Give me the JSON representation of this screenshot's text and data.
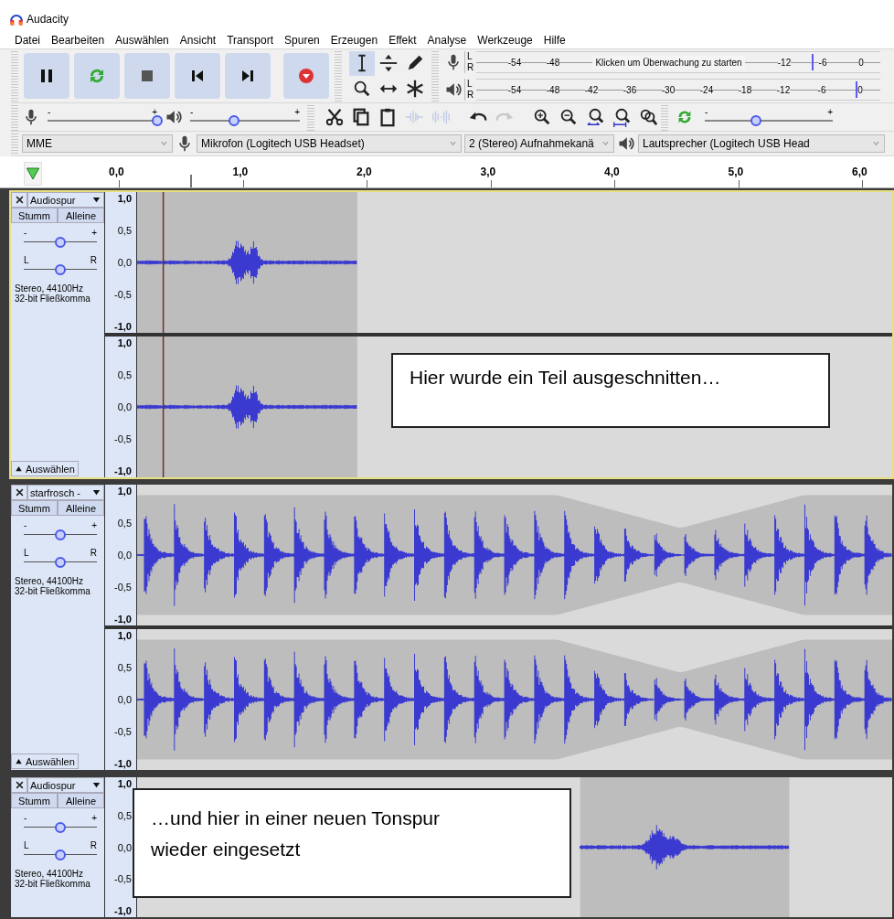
{
  "window": {
    "title": "Audacity"
  },
  "menu": [
    "Datei",
    "Bearbeiten",
    "Auswählen",
    "Ansicht",
    "Transport",
    "Spuren",
    "Erzeugen",
    "Effekt",
    "Analyse",
    "Werkzeuge",
    "Hilfe"
  ],
  "transport": [
    {
      "kind": "pause"
    },
    {
      "kind": "loop"
    },
    {
      "kind": "stop"
    },
    {
      "kind": "skip_start"
    },
    {
      "kind": "skip_end"
    },
    {
      "kind": "record"
    }
  ],
  "tools": [
    {
      "kind": "select",
      "selected": true
    },
    {
      "kind": "envelope",
      "selected": false
    },
    {
      "kind": "draw",
      "selected": false
    },
    {
      "kind": "zoom",
      "selected": false
    },
    {
      "kind": "timeshift",
      "selected": false
    },
    {
      "kind": "multi",
      "selected": false
    }
  ],
  "meters": [
    {
      "kind": "record",
      "channels": [
        "L",
        "R"
      ],
      "message": "Klicken um Überwachung zu starten",
      "ticks": [
        "-54",
        "-48",
        "-12",
        "-6",
        "0"
      ],
      "level": 0.83
    },
    {
      "kind": "playback",
      "channels": [
        "L",
        "R"
      ],
      "ticks": [
        "-54",
        "-48",
        "-42",
        "-36",
        "-30",
        "-24",
        "-18",
        "-12",
        "-6",
        "0"
      ],
      "level": 0.94
    }
  ],
  "mixer": [
    {
      "kind": "mic",
      "min": "-",
      "max": "+",
      "level": 1.0
    },
    {
      "kind": "speaker",
      "min": "-",
      "max": "+",
      "level": 0.4
    }
  ],
  "edit_tools": [
    {
      "kind": "cut",
      "disabled": false
    },
    {
      "kind": "copy",
      "disabled": false
    },
    {
      "kind": "paste",
      "disabled": false
    },
    {
      "kind": "trim",
      "disabled": true
    },
    {
      "kind": "silence",
      "disabled": true
    },
    {
      "kind": "undo",
      "disabled": false
    },
    {
      "kind": "redo",
      "disabled": true
    },
    {
      "kind": "zoom_in",
      "disabled": false
    },
    {
      "kind": "zoom_out",
      "disabled": false
    },
    {
      "kind": "fit_selection",
      "disabled": false
    },
    {
      "kind": "fit_project",
      "disabled": false
    },
    {
      "kind": "zoom_toggle",
      "disabled": false
    }
  ],
  "play_at_speed": {
    "min": "-",
    "max": "+",
    "level": 0.4
  },
  "devices": [
    {
      "kind": "host",
      "value": "MME"
    },
    {
      "kind": "mic",
      "value": "Mikrofon (Logitech USB Headset)"
    },
    {
      "kind": "channels",
      "value": "2 (Stereo) Aufnahmekanä"
    },
    {
      "kind": "speaker",
      "value": "Lautsprecher (Logitech USB Head"
    }
  ],
  "timeline": {
    "ticks": [
      "0,0",
      "1,0",
      "2,0",
      "3,0",
      "4,0",
      "5,0",
      "6,0"
    ]
  },
  "tracks": [
    {
      "name": "Audiospur",
      "selected": true,
      "mute": "Stumm",
      "solo": "Alleine",
      "clip": {
        "kind": "cut"
      },
      "sliders": [
        {
          "min": "-",
          "max": "+",
          "level": 0.5
        },
        {
          "min": "L",
          "max": "R",
          "level": 0.5
        }
      ],
      "info": [
        "Stereo, 44100Hz",
        "32-bit Fließkomma"
      ],
      "select_label": "Auswählen",
      "channels": [
        {
          "scale": [
            "1,0",
            "0,5",
            "0,0",
            "-0,5",
            "-1,0"
          ]
        },
        {
          "scale": [
            "1,0",
            "0,5",
            "0,0",
            "-0,5",
            "-1,0"
          ]
        }
      ],
      "note": [
        "Hier wurde ein Teil ausgeschnitten…"
      ]
    },
    {
      "name": "starfrosch -",
      "selected": false,
      "mute": "Stumm",
      "solo": "Alleine",
      "clip": {
        "kind": "envelope"
      },
      "sliders": [
        {
          "min": "-",
          "max": "+",
          "level": 0.5
        },
        {
          "min": "L",
          "max": "R",
          "level": 0.5
        }
      ],
      "info": [
        "Stereo, 44100Hz",
        "32-bit Fließkomma"
      ],
      "select_label": "Auswählen",
      "channels": [
        {
          "scale": [
            "1,0",
            "0,5",
            "0,0",
            "-0,5",
            "-1,0"
          ]
        },
        {
          "scale": [
            "1,0",
            "0,5",
            "0,0",
            "-0,5",
            "-1,0"
          ]
        }
      ]
    },
    {
      "name": "Audiospur",
      "selected": false,
      "mute": "Stumm",
      "solo": "Alleine",
      "clip": {
        "kind": "moved"
      },
      "sliders": [
        {
          "min": "-",
          "max": "+",
          "level": 0.5
        },
        {
          "min": "L",
          "max": "R",
          "level": 0.5
        }
      ],
      "info": [
        "Stereo, 44100Hz",
        "32-bit Fließkomma"
      ],
      "channels": [
        {
          "scale": [
            "1,0",
            "0,5",
            "0,0",
            "-0,5",
            "-1,0"
          ]
        }
      ],
      "note": [
        "…und hier in einer neuen Tonspur",
        "wieder eingesetzt"
      ]
    }
  ]
}
